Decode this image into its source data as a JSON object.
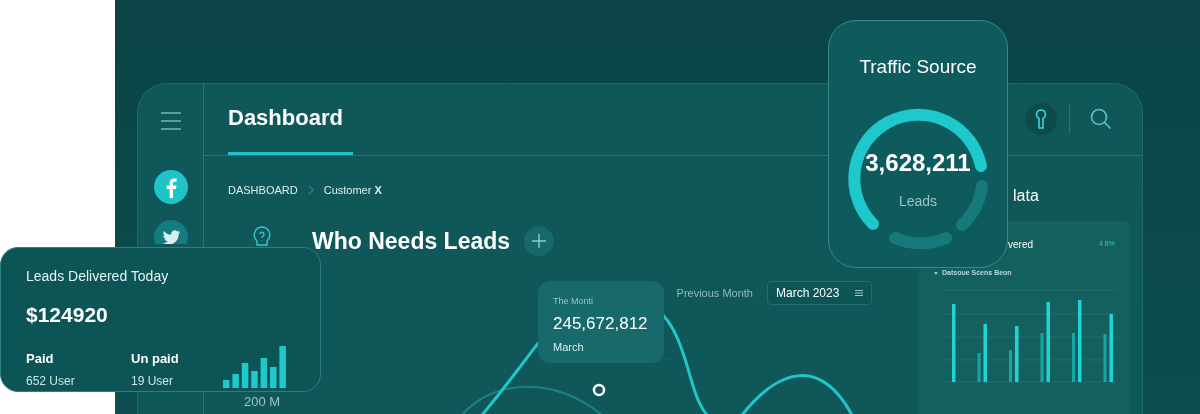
{
  "tabs": [
    {
      "label": "Dashboard",
      "selected": true
    }
  ],
  "breadcrumb": [
    "DASHBOARD",
    "Customer **X**"
  ],
  "leads_section": {
    "title": "Who Needs Leads",
    "axis_label": "200 M",
    "tooltip": {
      "label": "The Monti",
      "value": "245,672,812",
      "month": "March"
    },
    "filter": {
      "label": "Previous Month",
      "value": "March 2023"
    }
  },
  "side_card": {
    "title": "lata",
    "subtitle": "vered",
    "change": "4 8%",
    "legend": "Datsoue Scens Beon"
  },
  "leads_card": {
    "title": "Leads Delivered Today",
    "amount": "$124920",
    "stats": [
      {
        "label": "Paid",
        "value": "652 User"
      },
      {
        "label": "Un paid",
        "value": "19 User"
      }
    ]
  },
  "traffic_card": {
    "title": "Traffic Source",
    "value": "3,628,211",
    "unit": "Leads"
  }
}
